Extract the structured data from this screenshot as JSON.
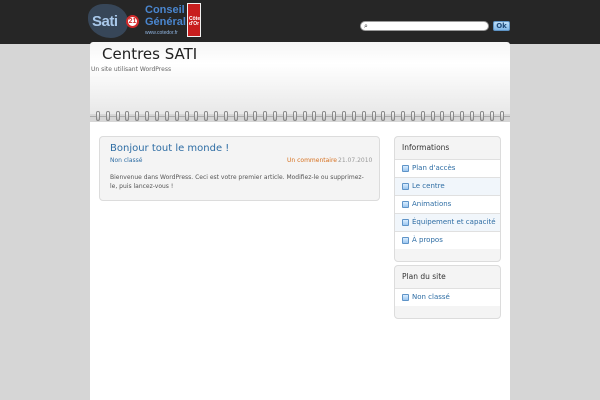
{
  "header": {
    "logo_sati_text": "Sati",
    "logo_sati_badge": "21",
    "logo_cg_line1": "Conseil",
    "logo_cg_line2": "Général",
    "logo_cg_url": "www.cotedor.fr",
    "logo_cg_badge": "Côte d'Or",
    "search_placeholder": "",
    "search_icon": "search-icon",
    "ok_label": "Ok"
  },
  "site": {
    "title": "Centres SATI",
    "description": "Un site utilisant WordPress"
  },
  "post": {
    "title": "Bonjour tout le monde !",
    "category": "Non classé",
    "comments": "Un commentaire",
    "date": "21.07.2010",
    "body": "Bienvenue dans WordPress. Ceci est votre premier article. Modifiez-le ou supprimez-le, puis lancez-vous !"
  },
  "sidebar": {
    "informations": {
      "title": "Informations",
      "items": [
        {
          "label": "Plan d'accès"
        },
        {
          "label": "Le centre"
        },
        {
          "label": "Animations"
        },
        {
          "label": "Équipement et capacité"
        },
        {
          "label": "À propos"
        }
      ]
    },
    "plan": {
      "title": "Plan du site",
      "items": [
        {
          "label": "Non classé"
        }
      ]
    }
  },
  "colors": {
    "topbar": "#262626",
    "link": "#2e6da4",
    "comments": "#d7701e",
    "background": "#d6d6d6"
  }
}
